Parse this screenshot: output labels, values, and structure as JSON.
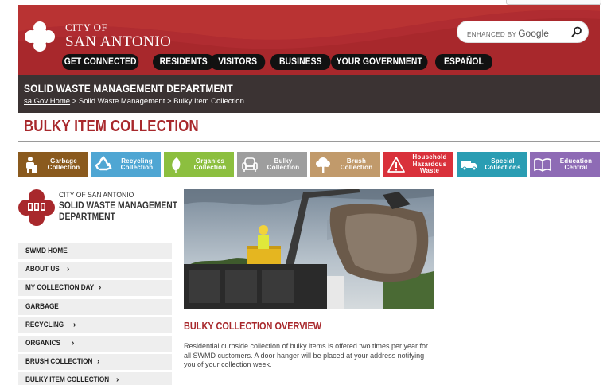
{
  "header": {
    "city_line1": "CITY OF",
    "city_line2": "SAN ANTONIO",
    "search_placeholder": "ENHANCED BY",
    "search_brand": "Google",
    "nav": [
      {
        "label": "GET CONNECTED"
      },
      {
        "label": "RESIDENTS"
      },
      {
        "label": "VISITORS"
      },
      {
        "label": "BUSINESS"
      },
      {
        "label": "YOUR GOVERNMENT"
      },
      {
        "label": "ESPAÑOL"
      }
    ]
  },
  "department": {
    "title": "SOLID WASTE MANAGEMENT DEPARTMENT",
    "breadcrumb": {
      "home": "sa.Gov Home",
      "sep1": " > ",
      "middle": "Solid Waste Management",
      "sep2": " > ",
      "current": "Bulky Item Collection"
    }
  },
  "page": {
    "title": "BULKY ITEM COLLECTION"
  },
  "tiles": [
    {
      "label": "Garbage\nCollection",
      "icon": "garbage-worker-icon",
      "color": "#8a5a1e"
    },
    {
      "label": "Recycling\nCollection",
      "icon": "recycle-icon",
      "color": "#4fa6d3"
    },
    {
      "label": "Organics\nCollection",
      "icon": "leaf-icon",
      "color": "#8cbf3f"
    },
    {
      "label": "Bulky\nCollection",
      "icon": "armchair-icon",
      "color": "#9e9e9e"
    },
    {
      "label": "Brush\nCollection",
      "icon": "tree-icon",
      "color": "#c19a6b"
    },
    {
      "label": "Household\nHazardous\nWaste",
      "icon": "warning-icon",
      "color": "#d9313b"
    },
    {
      "label": "Special\nCollections",
      "icon": "truck-icon",
      "color": "#2a9db3"
    },
    {
      "label": "Education\nCentral",
      "icon": "book-icon",
      "color": "#8e6bb5"
    }
  ],
  "sidebar": {
    "logo_line1": "CITY OF SAN ANTONIO",
    "logo_line2": "SOLID WASTE MANAGEMENT",
    "logo_line3": "DEPARTMENT",
    "items": [
      {
        "label": "SWMD HOME",
        "chevron": ""
      },
      {
        "label": "ABOUT US",
        "chevron": "›"
      },
      {
        "label": "MY COLLECTION DAY",
        "chevron": "›"
      },
      {
        "label": "GARBAGE",
        "chevron": ""
      },
      {
        "label": "RECYCLING",
        "chevron": "›"
      },
      {
        "label": "ORGANICS",
        "chevron": "›"
      },
      {
        "label": "BRUSH COLLECTION",
        "chevron": "›"
      },
      {
        "label": "BULKY ITEM COLLECTION",
        "chevron": "›"
      }
    ]
  },
  "main": {
    "overview_heading": "BULKY COLLECTION OVERVIEW",
    "overview_body": "Residential curbside collection of bulky items is offered two times per year for all SWMD customers. A door hanger will be placed at your address notifying you of your collection week."
  },
  "colors": {
    "brand_red": "#a8282c",
    "dept_bar": "#3b3333"
  }
}
